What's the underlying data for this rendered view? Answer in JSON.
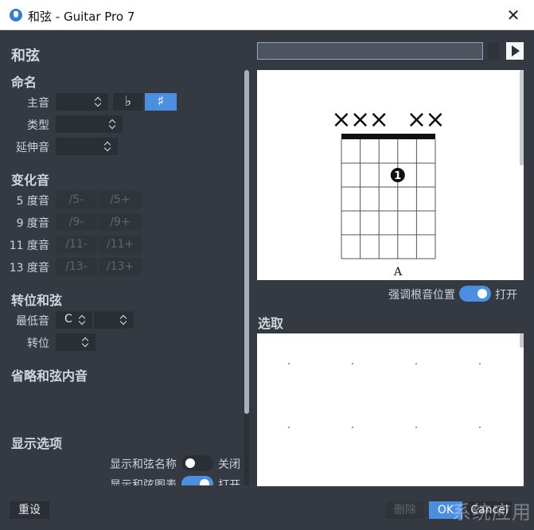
{
  "window": {
    "title": "和弦 - Guitar Pro 7"
  },
  "left": {
    "heading": "和弦",
    "naming": {
      "title": "命名",
      "root_label": "主音",
      "root_value": "",
      "flat": "♭",
      "sharp": "♯",
      "type_label": "类型",
      "type_value": "",
      "ext_label": "延伸音",
      "ext_value": ""
    },
    "alterations": {
      "title": "变化音",
      "rows": [
        {
          "label": "5 度音",
          "minus": "/5-",
          "plus": "/5+"
        },
        {
          "label": "9 度音",
          "minus": "/9-",
          "plus": "/9+"
        },
        {
          "label": "11 度音",
          "minus": "/11-",
          "plus": "/11+"
        },
        {
          "label": "13 度音",
          "minus": "/13-",
          "plus": "/13+"
        }
      ]
    },
    "inversion": {
      "title": "转位和弦",
      "bass_label": "最低音",
      "bass_value": "C",
      "bass_value2": "",
      "inv_label": "转位",
      "inv_value": ""
    },
    "omit": {
      "title": "省略和弦内音"
    },
    "display": {
      "title": "显示选项",
      "show_name_label": "显示和弦名称",
      "show_name_state": "关闭",
      "show_diagram_label": "显示和弦图表",
      "show_diagram_state": "打开"
    }
  },
  "right": {
    "diagram": {
      "string_marks": [
        "×",
        "×",
        "×",
        "",
        "×",
        "×"
      ],
      "finger": "1",
      "finger_string": 4,
      "finger_fret": 2,
      "chord_name": "A",
      "frets": 5,
      "strings": 6
    },
    "emphasize_root_label": "强调根音位置",
    "emphasize_root_state": "打开",
    "select_title": "选取"
  },
  "footer": {
    "reset": "重设",
    "delete": "删除",
    "ok": "OK",
    "cancel": "Cancel",
    "watermark": "系统应用"
  },
  "colors": {
    "accent": "#4b8fe0",
    "panel": "#353a42",
    "control": "#2a2f36"
  }
}
